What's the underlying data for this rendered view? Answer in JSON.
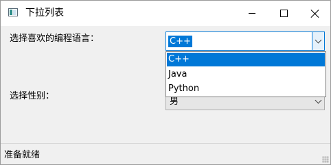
{
  "window": {
    "title": "下拉列表",
    "icon": "app-window-icon"
  },
  "form": {
    "language_label": "选择喜欢的编程语言：",
    "language_value": "C++",
    "language_options": [
      "C++",
      "Java",
      "Python"
    ],
    "gender_label": "选择性别：",
    "gender_value": "男"
  },
  "status": {
    "text": "准备就绪"
  },
  "colors": {
    "accent": "#0078d7",
    "window_bg": "#f0f0f0"
  }
}
